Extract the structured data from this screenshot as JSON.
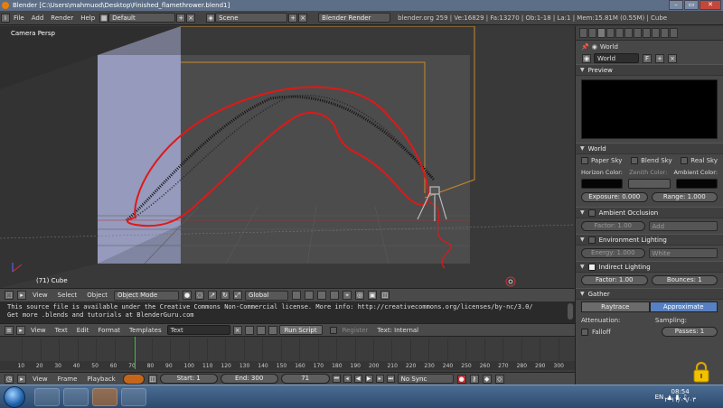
{
  "window": {
    "title": "Blender [C:\\Users\\mahmuod\\Desktop\\Finished_flamethrower.blend1]"
  },
  "infobar": {
    "menus": [
      "File",
      "Add",
      "Render",
      "Help"
    ],
    "screen": "Default",
    "scene": "Scene",
    "engine": "Blender Render",
    "stats": "blender.org 259 | Ve:16829 | Fa:13270 | Ob:1-18 | La:1 | Mem:15.81M (0.55M) | Cube"
  },
  "viewport": {
    "label": "Camera Persp",
    "object": "(71) Cube",
    "header": {
      "menus": [
        "View",
        "Select",
        "Object"
      ],
      "mode": "Object Mode",
      "orientation": "Global"
    }
  },
  "text_editor": {
    "line1": "This source file is available under the Creative Commons Non-Commercial license. More info: http://creativecommons.org/licenses/by-nc/3.0/",
    "line2": "Get more .blends and tutorials at BlenderGuru.com",
    "header": {
      "menus": [
        "View",
        "Text",
        "Edit",
        "Format",
        "Templates"
      ],
      "datablock": "Text",
      "run_script": "Run Script",
      "register": "Register",
      "status": "Text: Internal"
    }
  },
  "timeline": {
    "ticks": [
      "10",
      "20",
      "30",
      "40",
      "50",
      "60",
      "70",
      "80",
      "90",
      "100",
      "110",
      "120",
      "130",
      "140",
      "150",
      "160",
      "170",
      "180",
      "190",
      "200",
      "210",
      "220",
      "230",
      "240",
      "250",
      "260",
      "270",
      "280",
      "290",
      "300"
    ],
    "current_frame": 71,
    "header": {
      "menus": [
        "View",
        "Frame",
        "Playback"
      ],
      "start": "Start: 1",
      "end": "End: 300",
      "frame": "71",
      "sync": "No Sync"
    }
  },
  "properties": {
    "context": "World",
    "world_name": "World",
    "world_flag": "F",
    "preview_label": "Preview",
    "world_panel": {
      "label": "World",
      "paper_sky": "Paper Sky",
      "blend_sky": "Blend Sky",
      "real_sky": "Real Sky",
      "horizon_color_label": "Horizon Color:",
      "zenith_color_label": "Zenith Color:",
      "ambient_color_label": "Ambient Color:",
      "horizon_color": "#050505",
      "zenith_color": "#5a5a5a",
      "ambient_color": "#050505",
      "exposure": "Exposure: 0.000",
      "range": "Range: 1.000"
    },
    "ambient_occlusion": {
      "label": "Ambient Occlusion",
      "factor": "Factor: 1.00",
      "blend": "Add"
    },
    "environment_lighting": {
      "label": "Environment Lighting",
      "energy": "Energy: 1.000",
      "color": "White"
    },
    "indirect_lighting": {
      "label": "Indirect Lighting",
      "factor": "Factor: 1.00",
      "bounces": "Bounces: 1"
    },
    "gather": {
      "label": "Gather",
      "raytrace": "Raytrace",
      "approximate": "Approximate",
      "attenuation": "Attenuation:",
      "sampling": "Sampling:",
      "falloff": "Falloff",
      "passes": "Passes: 1"
    }
  },
  "taskbar": {
    "language": "EN",
    "time": "08:54",
    "date": "٢٠١١/٠٩/٠٣"
  }
}
